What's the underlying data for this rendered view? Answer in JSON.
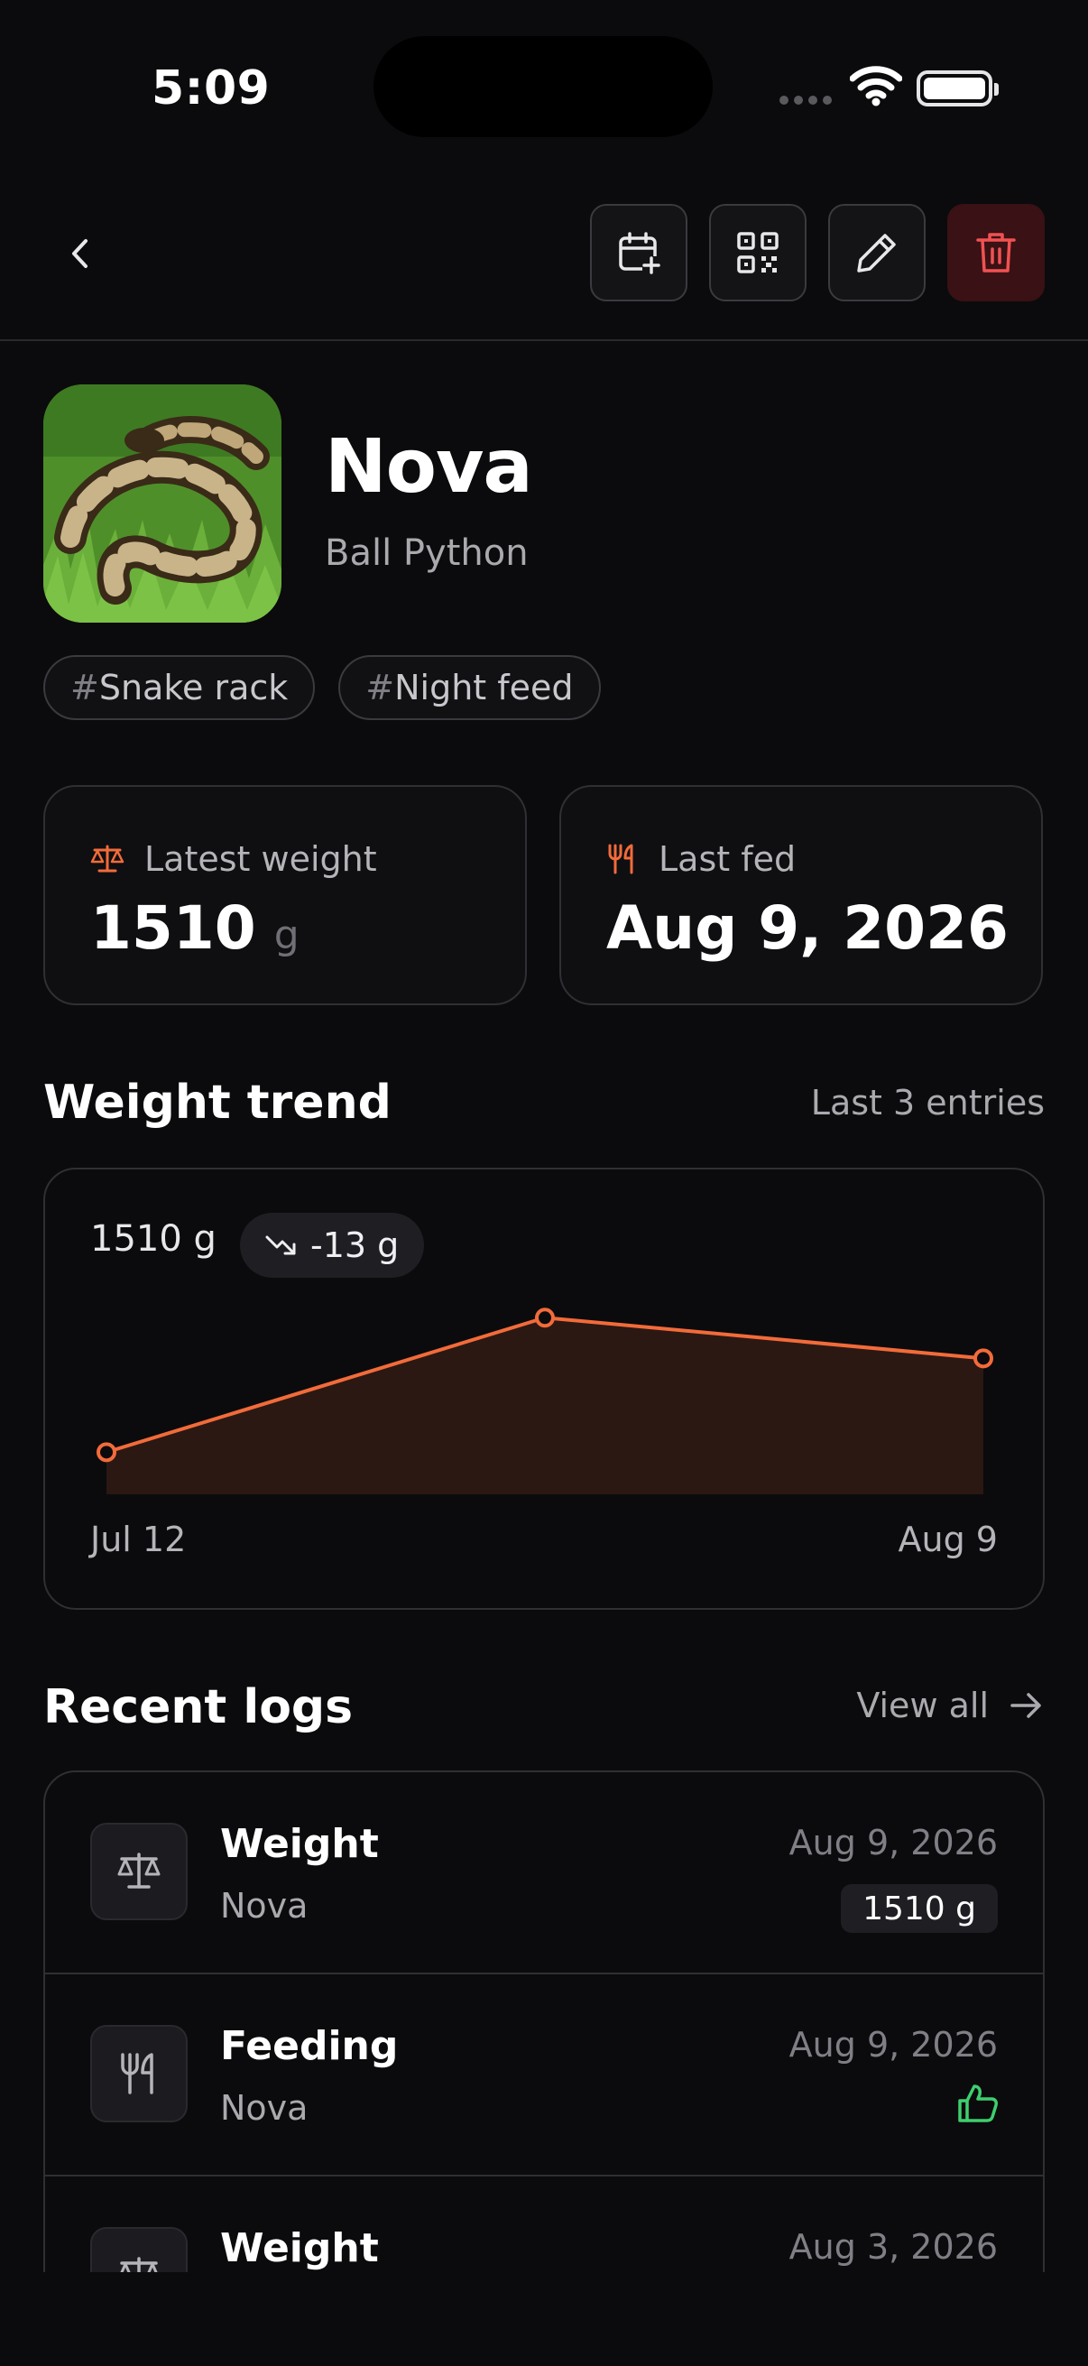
{
  "status_bar": {
    "time": "5:09"
  },
  "pet": {
    "name": "Nova",
    "species": "Ball Python",
    "tags": [
      {
        "hash": "#",
        "label": "Snake rack"
      },
      {
        "hash": "#",
        "label": "Night feed"
      }
    ]
  },
  "stats": {
    "weight": {
      "label": "Latest weight",
      "value": "1510",
      "unit": "g"
    },
    "fed": {
      "label": "Last fed",
      "value": "Aug 9, 2026"
    }
  },
  "trend": {
    "title": "Weight trend",
    "aside": "Last 3 entries",
    "current": "1510 g",
    "delta": "-13 g",
    "start_label": "Jul 12",
    "end_label": "Aug 9"
  },
  "chart_data": {
    "type": "area",
    "title": "Weight trend",
    "x": [
      "Jul 12",
      "",
      "Aug 9"
    ],
    "values": [
      1480,
      1523,
      1510
    ],
    "ylim": [
      1470,
      1530
    ],
    "grid": false,
    "color": "#f26b3a"
  },
  "logs": {
    "title": "Recent logs",
    "view_all": "View all",
    "items": [
      {
        "type": "Weight",
        "pet": "Nova",
        "date": "Aug 9, 2026",
        "badge": "1510 g",
        "icon": "scale-icon"
      },
      {
        "type": "Feeding",
        "pet": "Nova",
        "date": "Aug 9, 2026",
        "icon": "utensils-icon",
        "status_icon": "thumbs-up-icon"
      },
      {
        "type": "Weight",
        "pet": "",
        "date": "Aug 3, 2026",
        "icon": "scale-icon"
      }
    ]
  },
  "colors": {
    "accent": "#f26b3a",
    "danger": "#f05252",
    "success": "#3ecf6e",
    "background": "#0b0b0d"
  }
}
